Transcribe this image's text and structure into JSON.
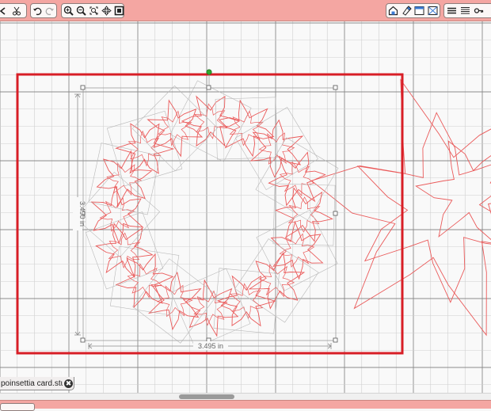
{
  "toolbar": {
    "left_group_1": [
      "back-icon",
      "cut-icon"
    ],
    "left_group_2": [
      "undo-icon",
      "redo-icon"
    ],
    "zoom_group": [
      "zoom-in-icon",
      "zoom-out-icon",
      "zoom-fit-icon",
      "pan-icon",
      "fit-page-icon"
    ],
    "right_group_1": [
      "home-icon",
      "paint-icon",
      "window-icon",
      "layout-icon"
    ],
    "right_group_2": [
      "align-icon",
      "distribute-icon",
      "key-icon"
    ]
  },
  "canvas": {
    "selection_height": "3.490 in",
    "selection_width": "3.495 in"
  },
  "document_tab": {
    "label": "poinsettia card.stu...",
    "close_symbol": "✖"
  },
  "colors": {
    "toolbar": "#f4a6a2",
    "cut_line": "#ea5a5a",
    "mat_border": "#d81e26",
    "selection_box": "#9c9c9c",
    "rotate_handle": "#2fa82f"
  }
}
